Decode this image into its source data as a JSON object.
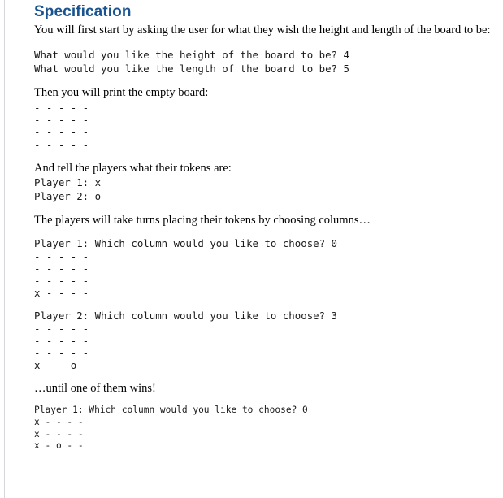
{
  "document": {
    "title": "Specification",
    "accent_color": "#1a5490",
    "rule_color": "#d4d6d9",
    "background": "#ffffff"
  },
  "intro": {
    "text": "You will first start by asking the user for what they wish the height and length of the board to be:"
  },
  "prompt_block": {
    "lines": "What would you like the height of the board to be? 4\nWhat would you like the length of the board to be? 5",
    "height_prompt": "What would you like the height of the board to be?",
    "height_value": "4",
    "length_prompt": "What would you like the length of the board to be?",
    "length_value": "5"
  },
  "empty_board_caption": {
    "text": "Then you will print the empty board:"
  },
  "empty_board": {
    "rows": "- - - - -\n- - - - -\n- - - - -\n- - - - -",
    "width": 5,
    "height": 4
  },
  "tokens_caption": {
    "text": "And tell the players what their tokens are:"
  },
  "tokens_block": {
    "lines": "Player 1: x\nPlayer 2: o",
    "player1_label": "Player 1:",
    "player1_token": "x",
    "player2_label": "Player 2:",
    "player2_token": "o"
  },
  "turns_caption": {
    "text": "The players will take turns placing their tokens by choosing columns…"
  },
  "turn_one": {
    "prompt": "Player 1: Which column would you like to choose? 0",
    "player": "Player 1",
    "question": "Which column would you like to choose?",
    "choice": "0",
    "board": "- - - - -\n- - - - -\n- - - - -\nx - - - -"
  },
  "turn_two": {
    "prompt": "Player 2: Which column would you like to choose? 3",
    "player": "Player 2",
    "question": "Which column would you like to choose?",
    "choice": "3",
    "board": "- - - - -\n- - - - -\n- - - - -\nx - - o -"
  },
  "until_caption": {
    "text": "…until one of them wins!"
  },
  "final_turn": {
    "prompt": "Player 1: Which column would you like to choose? 0",
    "player": "Player 1",
    "question": "Which column would you like to choose?",
    "choice": "0",
    "board": "x - - - -\nx - - - -\nx - o - -"
  }
}
